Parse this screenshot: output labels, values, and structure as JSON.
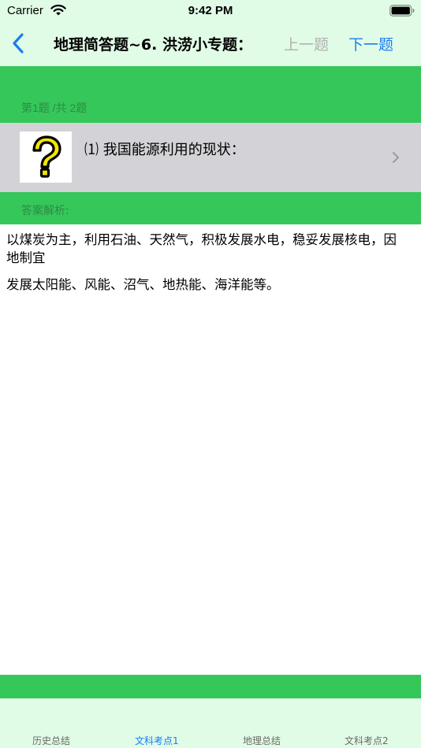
{
  "status": {
    "carrier": "Carrier",
    "time": "9:42 PM"
  },
  "nav": {
    "title": "地理简答题~6. 洪涝小专题：",
    "prev_label": "上一题",
    "next_label": "下一题"
  },
  "question": {
    "count": "第1题 /共 2题",
    "text": "⑴ 我国能源利用的现状："
  },
  "answer": {
    "label": "答案解析:",
    "paragraphs": [
      "以煤炭为主，利用石油、天然气，积极发展水电，稳妥发展核电，因地制宜",
      "发展太阳能、风能、沼气、地热能、海洋能等。"
    ]
  },
  "tabs": [
    {
      "label": "历史总结",
      "active": false
    },
    {
      "label": "文科考点1",
      "active": true
    },
    {
      "label": "地理总结",
      "active": false
    },
    {
      "label": "文科考点2",
      "active": false
    }
  ],
  "colors": {
    "accent": "#1a7cf4",
    "green": "#35c75a",
    "light_green": "#e1fce6",
    "row_gray": "#d2d2d7"
  },
  "icons": {
    "back": "chevron-left-icon",
    "question": "question-mark-icon",
    "disclosure": "chevron-right-icon"
  }
}
